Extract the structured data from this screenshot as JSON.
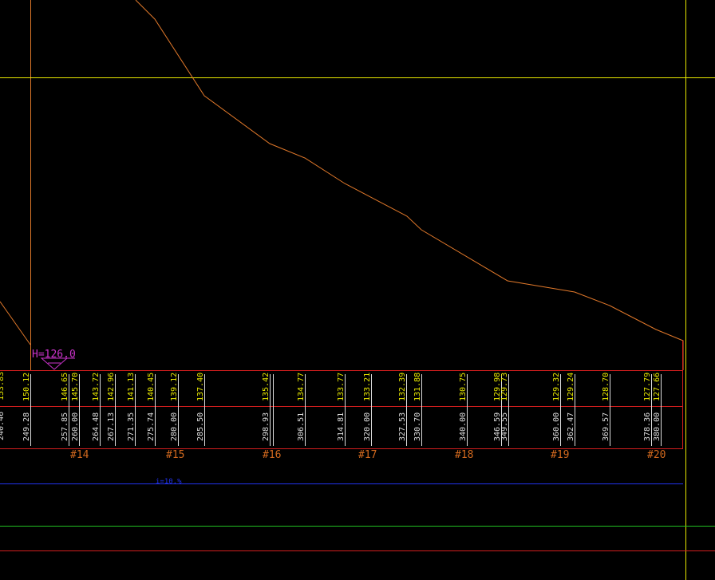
{
  "colors": {
    "background": "#000000",
    "profile": "#e0782a",
    "yellow": "#e8e800",
    "red": "#d21e1e",
    "white": "#dcdcdc",
    "magenta": "#cc33cc",
    "blue": "#2233ee",
    "green": "#22c022",
    "orange_label": "#d2691e"
  },
  "water_level": {
    "label": "H=126.0"
  },
  "slope_label": "i=10.%",
  "stations": [
    {
      "label": "#14"
    },
    {
      "label": "#15"
    },
    {
      "label": "#16"
    },
    {
      "label": "#17"
    },
    {
      "label": "#18"
    },
    {
      "label": "#19"
    },
    {
      "label": "#20"
    }
  ],
  "elevations": [
    {
      "value": "150.12"
    },
    {
      "value": "146.65"
    },
    {
      "value": "145.70"
    },
    {
      "value": "143.72"
    },
    {
      "value": "142.96"
    },
    {
      "value": "141.13"
    },
    {
      "value": "140.45"
    },
    {
      "value": "139.12"
    },
    {
      "value": "137.40"
    },
    {
      "value": "135.42"
    },
    {
      "value": "134.77"
    },
    {
      "value": "133.77"
    },
    {
      "value": "133.21"
    },
    {
      "value": "132.39"
    },
    {
      "value": "131.88"
    },
    {
      "value": "130.75"
    },
    {
      "value": "129.98"
    },
    {
      "value": "129.73"
    },
    {
      "value": "129.32"
    },
    {
      "value": "129.24"
    },
    {
      "value": "128.70"
    },
    {
      "value": "127.79"
    },
    {
      "value": "127.66"
    }
  ],
  "distances": [
    {
      "value": "249.28"
    },
    {
      "value": "257.85"
    },
    {
      "value": "260.00"
    },
    {
      "value": "264.48"
    },
    {
      "value": "267.13"
    },
    {
      "value": "271.35"
    },
    {
      "value": "275.74"
    },
    {
      "value": "280.00"
    },
    {
      "value": "285.50"
    },
    {
      "value": "298.93"
    },
    {
      "value": "306.51"
    },
    {
      "value": "314.81"
    },
    {
      "value": "320.00"
    },
    {
      "value": "327.53"
    },
    {
      "value": "330.70"
    },
    {
      "value": "340.00"
    },
    {
      "value": "346.59"
    },
    {
      "value": "349.55"
    },
    {
      "value": "360.00"
    },
    {
      "value": "362.47"
    },
    {
      "value": "369.57"
    },
    {
      "value": "378.36"
    },
    {
      "value": "380.00"
    }
  ]
}
